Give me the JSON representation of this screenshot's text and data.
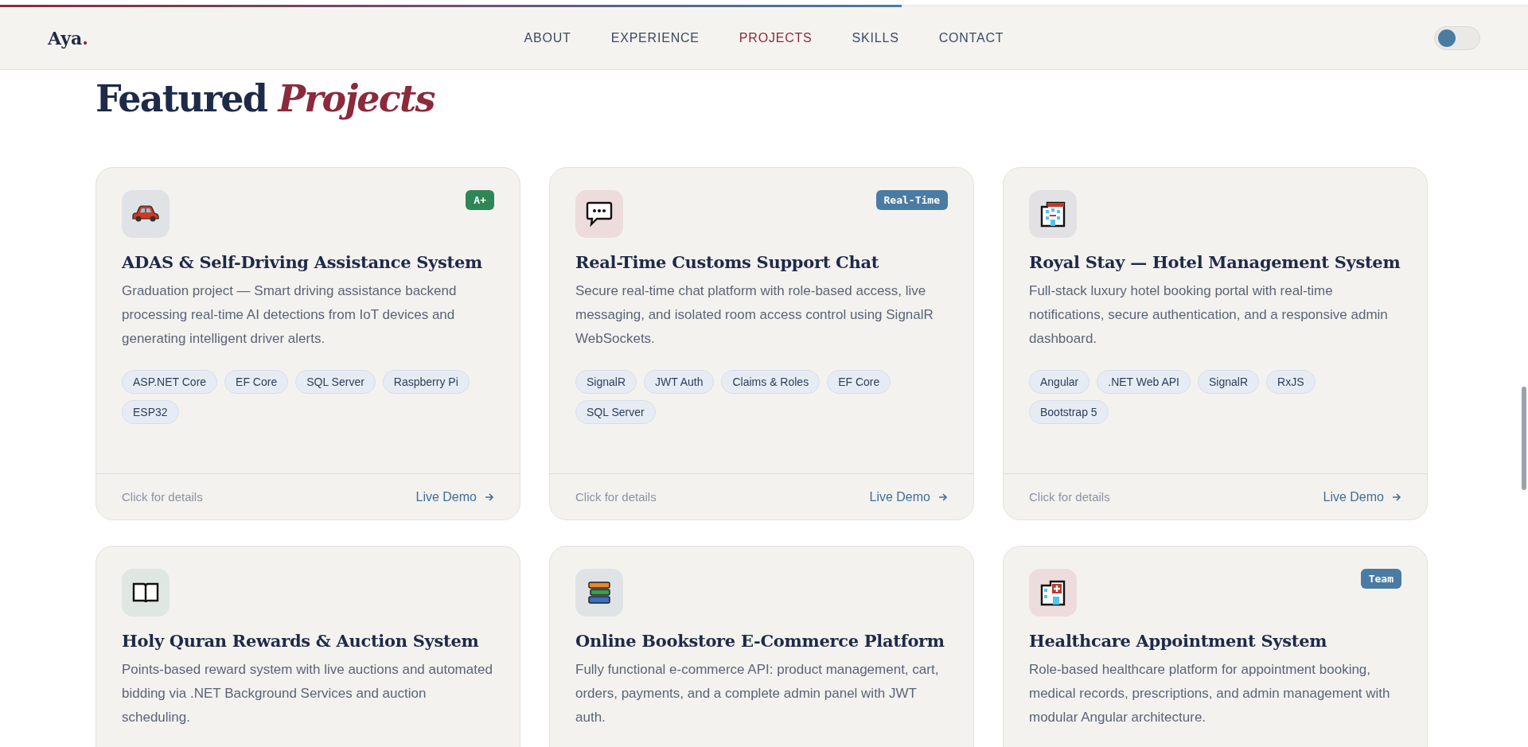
{
  "scroll_progress": {
    "level": 0.59
  },
  "nav": {
    "logo": "Aya",
    "logo_dot": ".",
    "links": [
      {
        "label": "ABOUT",
        "selected": false
      },
      {
        "label": "EXPERIENCE",
        "selected": false
      },
      {
        "label": "PROJECTS",
        "selected": true
      },
      {
        "label": "SKILLS",
        "selected": false
      },
      {
        "label": "CONTACT",
        "selected": false
      }
    ],
    "theme_toggle": {
      "on": false
    }
  },
  "section": {
    "title": "Featured",
    "title_accent": "Projects"
  },
  "projects": [
    {
      "badge": {
        "label": "A+",
        "color": "#2e8555"
      },
      "title": "ADAS & Self-Driving Assistance System",
      "description": "Graduation project — Smart driving assistance backend processing real-time AI detections from IoT devices and generating intelligent driver alerts.",
      "tags": [
        "ASP.NET Core",
        "EF Core",
        "SQL Server",
        "Raspberry Pi",
        "ESP32"
      ],
      "hint": "Click for details",
      "link": "Live Demo"
    },
    {
      "badge": {
        "label": "Real-Time",
        "color": "#4a7ba3"
      },
      "title": "Real-Time Customs Support Chat",
      "description": "Secure real-time chat platform with role-based access, live messaging, and isolated room access control using SignalR WebSockets.",
      "tags": [
        "SignalR",
        "JWT Auth",
        "Claims & Roles",
        "EF Core",
        "SQL Server"
      ],
      "hint": "Click for details",
      "link": "Live Demo"
    },
    {
      "title": "Royal Stay — Hotel Management System",
      "description": "Full-stack luxury hotel booking portal with real-time notifications, secure authentication, and a responsive admin dashboard.",
      "tags": [
        "Angular",
        ".NET Web API",
        "SignalR",
        "RxJS",
        "Bootstrap 5"
      ],
      "hint": "Click for details",
      "link": "Live Demo"
    },
    {
      "title": "Holy Quran Rewards & Auction System",
      "description": "Points-based reward system with live auctions and automated bidding via .NET Background Services and auction scheduling."
    },
    {
      "title": "Online Bookstore E-Commerce Platform",
      "description": "Fully functional e-commerce API: product management, cart, orders, payments, and a complete admin panel with JWT auth."
    },
    {
      "badge": {
        "label": "Team",
        "color": "#4a7ba3"
      },
      "title": "Healthcare Appointment System",
      "description": "Role-based healthcare platform for appointment booking, medical records, prescriptions, and admin management with modular Angular architecture."
    }
  ]
}
